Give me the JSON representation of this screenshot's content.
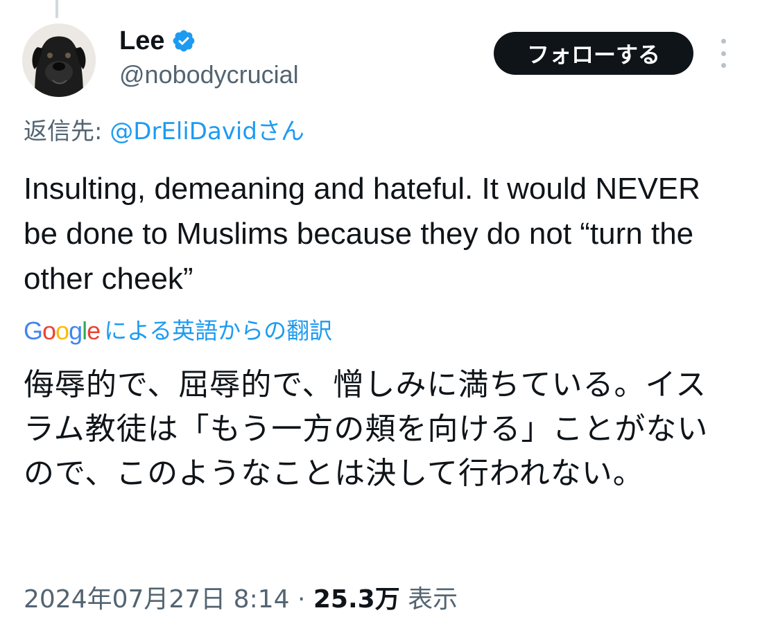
{
  "author": {
    "display_name": "Lee",
    "handle": "@nobodycrucial",
    "verified_icon": "verified-badge-icon",
    "avatar_icon": "dog-avatar"
  },
  "actions": {
    "follow_label": "フォローする",
    "more_icon": "more-vertical-icon"
  },
  "reply": {
    "prefix": "返信先: ",
    "mention": "@DrEliDavidさん"
  },
  "tweet": {
    "text": "Insulting, demeaning and hateful. It would NEVER be done to Muslims because they do not “turn the other cheek”"
  },
  "translation": {
    "provider_logo": "Google",
    "label": "による英語からの翻訳",
    "text": "侮辱的で、屈辱的で、憎しみに満ちている。イスラム教徒は「もう一方の頬を向ける」ことがないので、このようなことは決して行われない。"
  },
  "meta": {
    "timestamp": "2024年07月27日 8:14",
    "separator": " · ",
    "views_count": "25.3万",
    "views_label": " 表示"
  },
  "colors": {
    "accent": "#1d9bf0",
    "text_primary": "#0f1419",
    "text_secondary": "#536471",
    "button_bg": "#0f1419"
  }
}
